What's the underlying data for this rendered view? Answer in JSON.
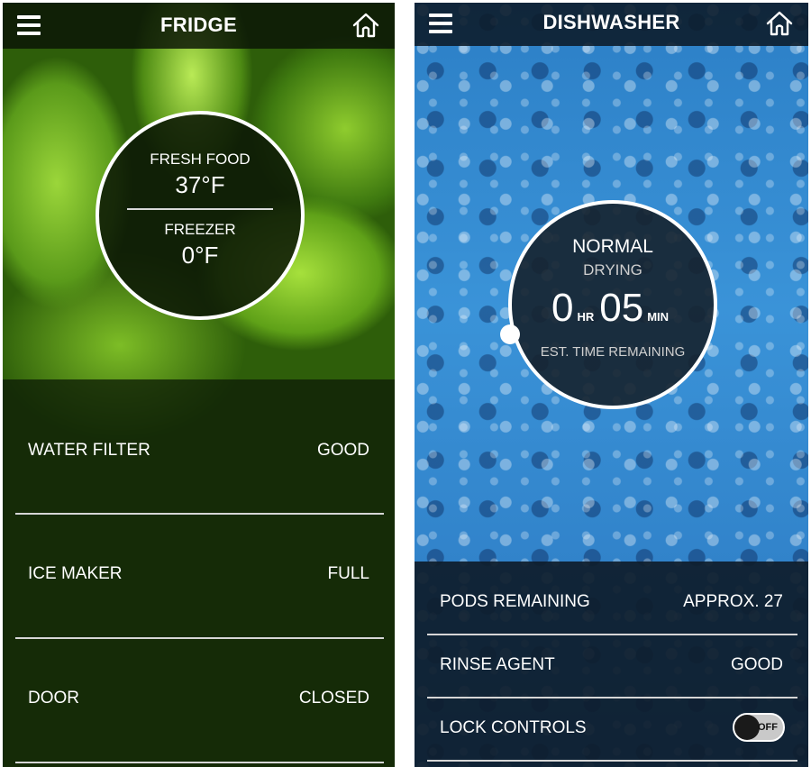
{
  "fridge": {
    "title": "FRIDGE",
    "menu_icon": "hamburger-menu-icon",
    "home_icon": "home-icon",
    "dial": {
      "fresh_food_label": "FRESH FOOD",
      "fresh_food_temp": "37°F",
      "freezer_label": "FREEZER",
      "freezer_temp": "0°F"
    },
    "status_rows": [
      {
        "label": "WATER FILTER",
        "value": "GOOD"
      },
      {
        "label": "ICE MAKER",
        "value": "FULL"
      },
      {
        "label": "DOOR",
        "value": "CLOSED"
      }
    ],
    "accent_color": "#6fae1e"
  },
  "dishwasher": {
    "title": "DISHWASHER",
    "menu_icon": "hamburger-menu-icon",
    "home_icon": "home-icon",
    "dial": {
      "cycle": "NORMAL",
      "phase": "DRYING",
      "hours": "0",
      "hours_unit": "HR",
      "minutes": "05",
      "minutes_unit": "MIN",
      "caption": "EST. TIME REMAINING"
    },
    "status_rows": [
      {
        "label": "PODS REMAINING",
        "value": "APPROX. 27"
      },
      {
        "label": "RINSE AGENT",
        "value": "GOOD"
      }
    ],
    "lock_controls": {
      "label": "LOCK CONTROLS",
      "state": "OFF"
    },
    "accent_color": "#2f86cc"
  }
}
